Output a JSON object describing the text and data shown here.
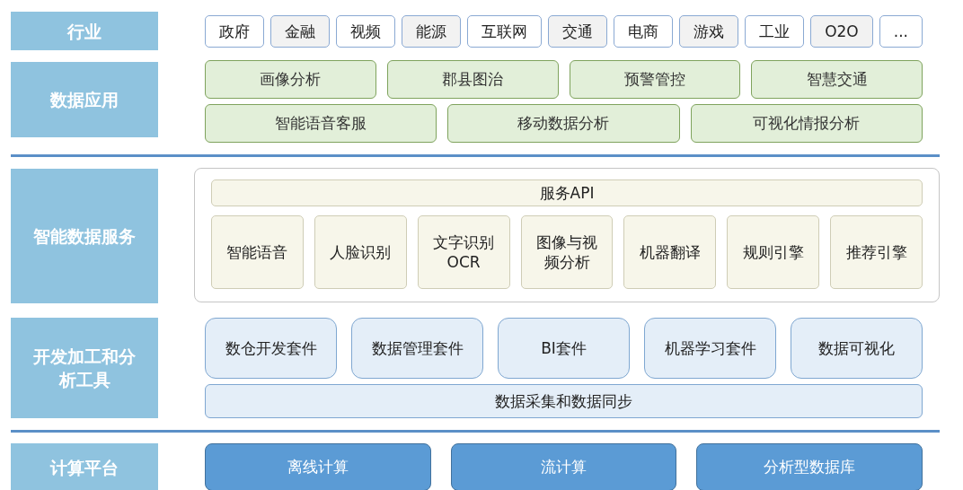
{
  "sections": [
    {
      "label": "行业",
      "kind": "tags",
      "items": [
        {
          "text": "政府",
          "color": "#ffffff"
        },
        {
          "text": "金融",
          "color": "#f2f2f2"
        },
        {
          "text": "视频",
          "color": "#ffffff"
        },
        {
          "text": "能源",
          "color": "#f2f2f2"
        },
        {
          "text": "互联网",
          "color": "#ffffff"
        },
        {
          "text": "交通",
          "color": "#f2f2f2"
        },
        {
          "text": "电商",
          "color": "#ffffff"
        },
        {
          "text": "游戏",
          "color": "#f2f2f2"
        },
        {
          "text": "工业",
          "color": "#ffffff"
        },
        {
          "text": "O2O",
          "color": "#f2f2f2"
        },
        {
          "text": "...",
          "color": "#ffffff"
        }
      ]
    },
    {
      "label": "数据应用",
      "kind": "apps",
      "groups": [
        {
          "items": [
            "画像分析",
            "郡县图治",
            "预警管控",
            "智慧交通"
          ]
        },
        {
          "items": [
            "智能语音客服",
            "移动数据分析",
            "可视化情报分析"
          ]
        }
      ]
    },
    {
      "kind": "divider"
    },
    {
      "label": "智能数据服务",
      "kind": "services",
      "api": "服务API",
      "items": [
        "智能语音",
        "人脸识别",
        "文字识别OCR",
        "图像与视频分析",
        "机器翻译",
        "规则引擎",
        "推荐引擎"
      ]
    },
    {
      "label": "开发加工和分析工具",
      "kind": "tools",
      "items": [
        "数仓开发套件",
        "数据管理套件",
        "BI套件",
        "机器学习套件",
        "数据可视化"
      ],
      "base": "数据采集和数据同步"
    },
    {
      "kind": "divider"
    },
    {
      "label": "计算平台",
      "kind": "compute",
      "items": [
        "离线计算",
        "流计算",
        "分析型数据库"
      ]
    }
  ]
}
